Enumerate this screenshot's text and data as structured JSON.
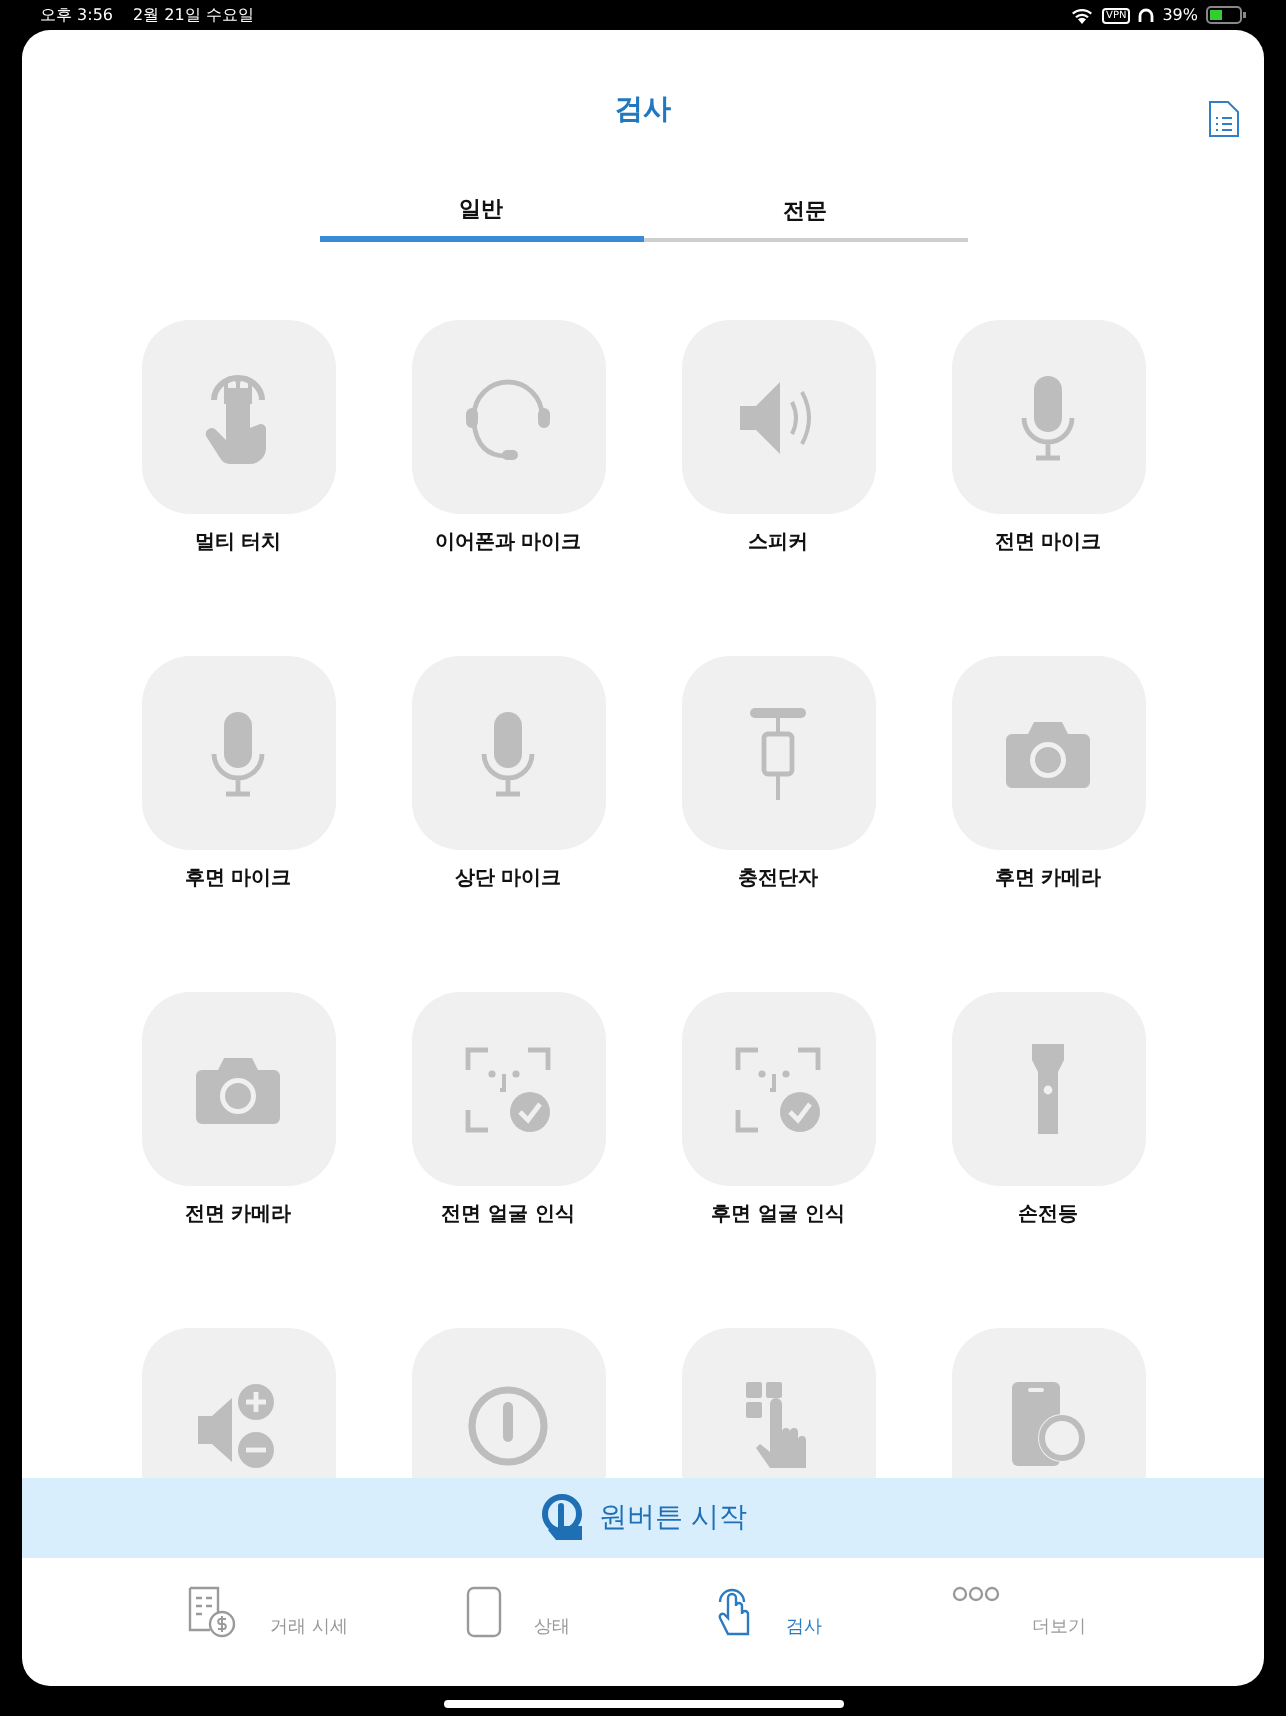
{
  "status_bar": {
    "time": "오후 3:56",
    "date": "2월 21일 수요일",
    "vpn": "VPN",
    "battery": "39%"
  },
  "header": {
    "title": "검사"
  },
  "tabs": [
    {
      "label": "일반",
      "selected": true
    },
    {
      "label": "전문",
      "selected": false
    }
  ],
  "tests": [
    {
      "kind": "touch",
      "label": "멀티 터치"
    },
    {
      "kind": "headset",
      "label": "이어폰과 마이크"
    },
    {
      "kind": "speaker",
      "label": "스피커"
    },
    {
      "kind": "mic",
      "label": "전면 마이크"
    },
    {
      "kind": "mic",
      "label": "후면 마이크"
    },
    {
      "kind": "mic",
      "label": "상단 마이크"
    },
    {
      "kind": "connector",
      "label": "충전단자"
    },
    {
      "kind": "camera",
      "label": "후면 카메라"
    },
    {
      "kind": "camera",
      "label": "전면 카메라"
    },
    {
      "kind": "face",
      "label": "전면 얼굴 인식"
    },
    {
      "kind": "face",
      "label": "후면 얼굴 인식"
    },
    {
      "kind": "flashlight",
      "label": "손전등"
    },
    {
      "kind": "volume"
    },
    {
      "kind": "power"
    },
    {
      "kind": "keypad"
    },
    {
      "kind": "phone-search"
    }
  ],
  "start_button": {
    "label": "원버튼 시작"
  },
  "nav": [
    {
      "kind": "price",
      "label": "거래 시세",
      "selected": false
    },
    {
      "kind": "phone",
      "label": "상태",
      "selected": false
    },
    {
      "kind": "touch",
      "label": "검사",
      "selected": true
    },
    {
      "kind": "more",
      "label": "더보기",
      "selected": false
    }
  ]
}
